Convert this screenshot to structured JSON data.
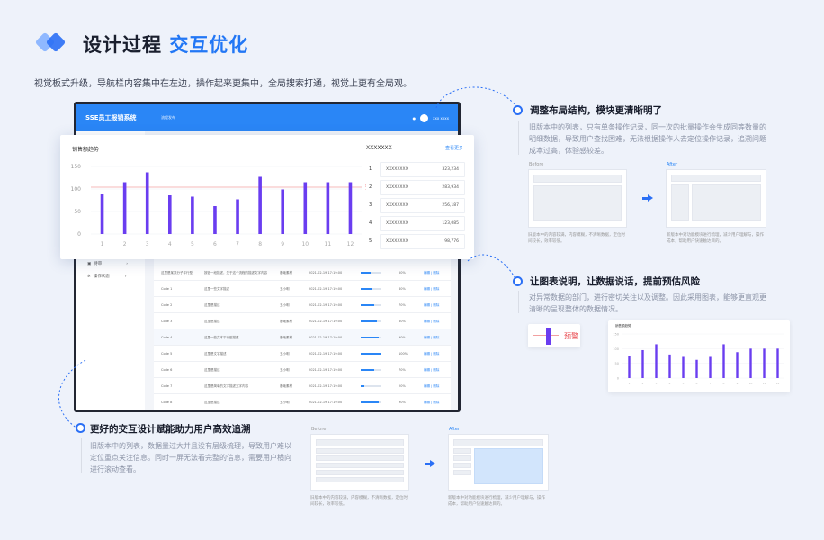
{
  "header": {
    "title_main": "设计过程",
    "title_highlight": "交互优化",
    "subtitle": "视觉板式升级，导航栏内容集中在左边，操作起来更集中，全局搜索打通，视觉上更有全局观。"
  },
  "app": {
    "brand": "SSE员工报销系统",
    "nav": "流程发布",
    "user": "xxx xxxx",
    "sidebar": [
      "待审",
      "操作状态"
    ],
    "rows": [
      {
        "code": "这里是某某分子平行型",
        "name": "按钮一段描述，关于这个流程的描述文字内容",
        "type": "基础素材",
        "date": "2021-02-19 17:19:00",
        "pct": 50,
        "act": "编辑 | 删除"
      },
      {
        "code": "Code 1",
        "name": "这里一些文字描述",
        "type": "王小明",
        "date": "2021-02-19 17:19:00",
        "pct": 60,
        "act": "编辑 | 删除"
      },
      {
        "code": "Code 2",
        "name": "这里是描述",
        "type": "王小明",
        "date": "2021-02-19 17:19:00",
        "pct": 70,
        "act": "编辑 | 删除"
      },
      {
        "code": "Code 3",
        "name": "这里是描述",
        "type": "基础素材",
        "date": "2021-02-19 17:19:00",
        "pct": 80,
        "act": "编辑 | 删除"
      },
      {
        "code": "Code 4",
        "name": "这里一些文本平行型描述",
        "type": "基础素材",
        "date": "2021-02-19 17:19:00",
        "pct": 90,
        "act": "编辑 | 删除"
      },
      {
        "code": "Code 5",
        "name": "这里是文字描述",
        "type": "王小明",
        "date": "2021-02-19 17:19:00",
        "pct": 100,
        "act": "编辑 | 删除"
      },
      {
        "code": "Code 6",
        "name": "这里是描述",
        "type": "王小明",
        "date": "2021-02-19 17:19:00",
        "pct": 70,
        "act": "编辑 | 删除"
      },
      {
        "code": "Code 7",
        "name": "这里是简单的文字描述文字内容",
        "type": "基础素材",
        "date": "2021-02-19 17:19:00",
        "pct": 20,
        "act": "编辑 | 删除"
      },
      {
        "code": "Code 8",
        "name": "这里是描述",
        "type": "王小明",
        "date": "2021-02-19 17:19:00",
        "pct": 90,
        "act": "编辑 | 删除"
      }
    ]
  },
  "sales_card": {
    "title": "销售额趋势",
    "rank_title": "XXXXXXX",
    "more": "查看更多",
    "warn_label": "预警",
    "ranking": [
      {
        "rank": "1",
        "name": "XXXXXXXX",
        "value": "323,234"
      },
      {
        "rank": "2",
        "name": "XXXXXXXX",
        "value": "283,934"
      },
      {
        "rank": "3",
        "name": "XXXXXXXX",
        "value": "256,187"
      },
      {
        "rank": "4",
        "name": "XXXXXXXX",
        "value": "123,085"
      },
      {
        "rank": "5",
        "name": "XXXXXXXX",
        "value": "98,776"
      }
    ]
  },
  "chart_data": {
    "type": "bar",
    "title": "销售额趋势",
    "categories": [
      "1",
      "2",
      "3",
      "4",
      "5",
      "6",
      "7",
      "8",
      "9",
      "10",
      "11",
      "12"
    ],
    "values": [
      88,
      115,
      137,
      86,
      83,
      62,
      77,
      127,
      99,
      115,
      115,
      115
    ],
    "yticks": [
      "0",
      "50",
      "100",
      "150"
    ],
    "ylim": [
      0,
      150
    ],
    "threshold": 104,
    "threshold_label": "预警",
    "bar_color": "#6a3df0",
    "threshold_color": "#f2a0a0"
  },
  "section1": {
    "heading": "调整布局结构，模块更清晰明了",
    "text": "旧版本中的列表，只有单条操作记录，同一次的批量操作会生成同等数量的明细数据，导致用户查找困难，无法根据操作人去定位操作记录，追溯问题成本过高，体验感较差。",
    "before_label": "Before",
    "after_label": "After",
    "before_caption": "旧版本中的内容较满，内容模糊，不清晰数据，定位时间较长，效率较低。",
    "after_caption": "新版本中对功能模块进行梳理，减少用户理解与，操作成本，帮助用户快速触达目的。"
  },
  "section2": {
    "heading": "让图表说明，让数据说话，提前预估风险",
    "text": "对异常数据的部门，进行密切关注以及调整。因此采用图表，能够更直观更清晰的呈现整体的数据情况。",
    "sticky_label": "预警",
    "mini_chart_title": "销售额趋势",
    "mini_values": [
      75,
      95,
      115,
      80,
      72,
      62,
      72,
      115,
      88,
      100,
      100,
      100
    ],
    "mini_yticks": [
      "0",
      "50",
      "100",
      "150"
    ]
  },
  "section3": {
    "heading": "更好的交互设计赋能助力用户高效追溯",
    "text": "旧版本中的列表，数据量过大并且没有层级梳理，导致用户难以定位重点关注信息。同时一屏无法看完整的信息，需要用户横向进行滚动查看。",
    "before_label": "Before",
    "after_label": "After",
    "before_caption": "旧版本中的内容较满，内容模糊，不清晰数据，定位时间较长，效率较低。",
    "after_caption": "新版本中对功能模块进行梳理，减少用户理解与，操作成本，帮助用户快速触达目的。"
  },
  "colors": {
    "accent": "#2a86f6",
    "bar": "#6a3df0",
    "warn": "#e8474c"
  }
}
